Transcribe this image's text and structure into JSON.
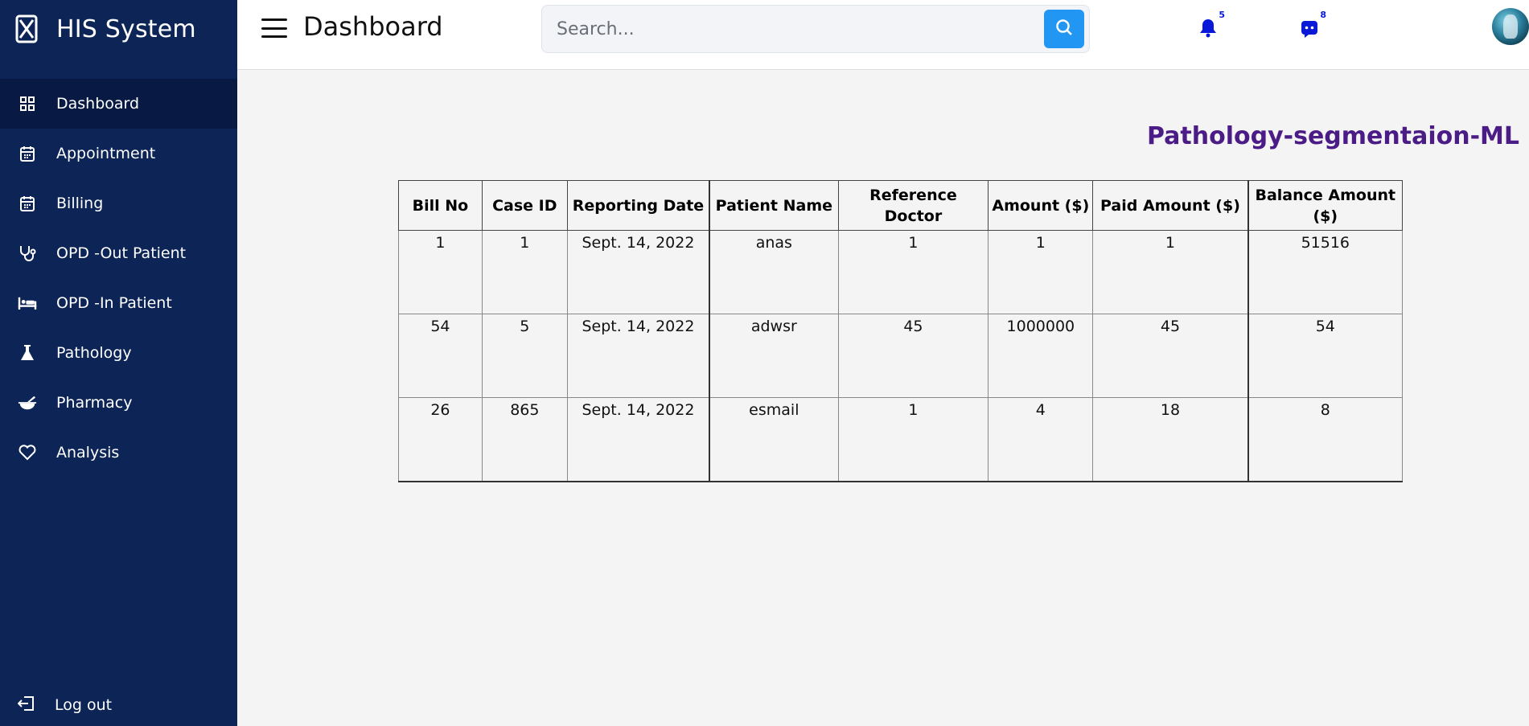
{
  "brand": {
    "name": "HIS System",
    "logo_icon": "close-box-icon"
  },
  "sidebar": {
    "items": [
      {
        "label": "Dashboard",
        "icon": "grid-icon",
        "active": true
      },
      {
        "label": "Appointment",
        "icon": "calendar-icon",
        "active": false
      },
      {
        "label": "Billing",
        "icon": "calendar-icon",
        "active": false
      },
      {
        "label": "OPD -Out Patient",
        "icon": "stethoscope-icon",
        "active": false
      },
      {
        "label": "OPD -In Patient",
        "icon": "bed-icon",
        "active": false
      },
      {
        "label": "Pathology",
        "icon": "flask-icon",
        "active": false
      },
      {
        "label": "Pharmacy",
        "icon": "mortar-pestle-icon",
        "active": false
      },
      {
        "label": "Analysis",
        "icon": "heart-icon",
        "active": false
      }
    ],
    "logout_label": "Log out"
  },
  "header": {
    "title": "Dashboard",
    "search_placeholder": "Search...",
    "notifications_count": "5",
    "messages_count": "8"
  },
  "main": {
    "section_title": "Pathology-segmentaion-ML",
    "table": {
      "headers": [
        "Bill No",
        "Case ID",
        "Reporting Date",
        "Patient Name",
        "Reference Doctor",
        "Amount ($)",
        "Paid Amount ($)",
        "Balance Amount ($)"
      ],
      "rows": [
        [
          "1",
          "1",
          "Sept. 14, 2022",
          "anas",
          "1",
          "1",
          "1",
          "51516"
        ],
        [
          "54",
          "5",
          "Sept. 14, 2022",
          "adwsr",
          "45",
          "1000000",
          "45",
          "54"
        ],
        [
          "26",
          "865",
          "Sept. 14, 2022",
          "esmail",
          "1",
          "4",
          "18",
          "8"
        ]
      ]
    }
  },
  "colors": {
    "sidebar_bg": "#0c2456",
    "sidebar_active": "#081a44",
    "search_button": "#2196f3",
    "section_title": "#4b1c86",
    "badge": "#0a19d8"
  }
}
